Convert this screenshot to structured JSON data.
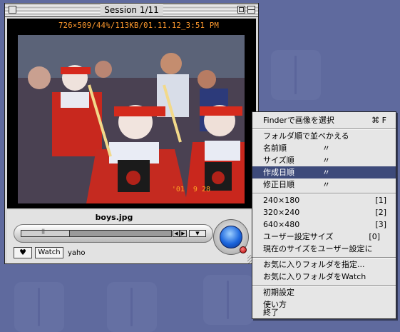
{
  "window": {
    "title": "Session 1/11",
    "info_line": "726×509/44%/113KB/01.11.12_3:51 PM",
    "photo_stamp": "'01  9 28",
    "filename": "boys.jpg",
    "heart_label": "♥",
    "watch_label": "Watch",
    "user_label": "yaho",
    "seek_position": 0.32
  },
  "context_menu": {
    "highlighted_index": 4,
    "items": [
      {
        "label": "Finderで画像を選択",
        "value": "",
        "shortcut": "⌘ F"
      },
      {
        "label": "フォルダ順で並べかえる",
        "value": "",
        "shortcut": ""
      },
      {
        "label": "名前順",
        "value": "〃",
        "shortcut": ""
      },
      {
        "label": "サイズ順",
        "value": "〃",
        "shortcut": ""
      },
      {
        "label": "作成日順",
        "value": "〃",
        "shortcut": ""
      },
      {
        "label": "修正日順",
        "value": "〃",
        "shortcut": ""
      },
      {
        "label": "240×180",
        "value": "",
        "shortcut": "[1]"
      },
      {
        "label": "320×240",
        "value": "",
        "shortcut": "[2]"
      },
      {
        "label": "640×480",
        "value": "",
        "shortcut": "[3]"
      },
      {
        "label": "ユーザー設定サイズ",
        "value": "",
        "shortcut": "[0]"
      },
      {
        "label": "現在のサイズをユーザー設定に",
        "value": "",
        "shortcut": ""
      },
      {
        "label": "お気に入りフォルダを指定...",
        "value": "",
        "shortcut": ""
      },
      {
        "label": "お気に入りフォルダをWatch",
        "value": "",
        "shortcut": ""
      },
      {
        "label": "初期設定",
        "value": "",
        "shortcut": ""
      },
      {
        "label": "使い方",
        "value": "",
        "shortcut": ""
      },
      {
        "label": "終了",
        "value": "",
        "shortcut": ""
      }
    ]
  },
  "colors": {
    "desktop": "#5f6a9e",
    "highlight": "#3d4a7a",
    "info_text": "#ff9a2e"
  }
}
